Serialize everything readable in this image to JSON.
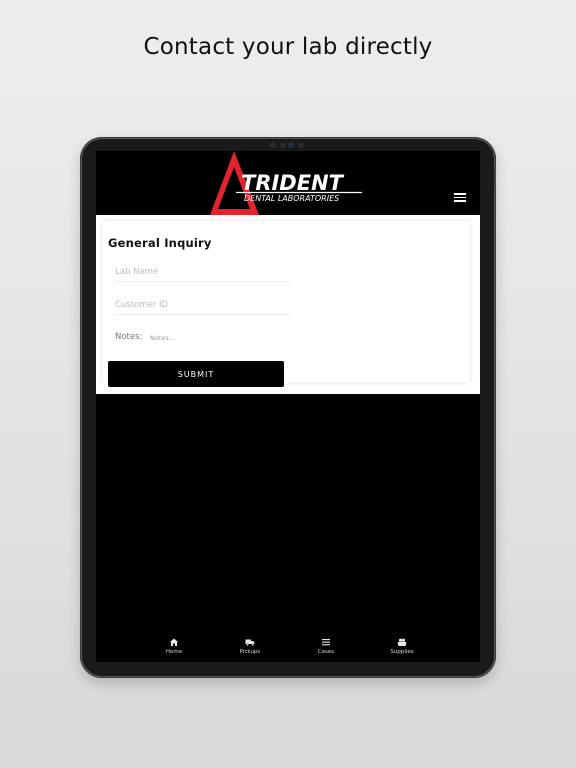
{
  "headline": "Contact your lab directly",
  "logo": {
    "brand": "TRIDENT",
    "tagline": "DENTAL LABORATORIES"
  },
  "form": {
    "title": "General Inquiry",
    "lab_name_placeholder": "Lab Name",
    "customer_id_placeholder": "Customer ID",
    "notes_label": "Notes:",
    "notes_placeholder": "Notes...",
    "submit_label": "SUBMIT"
  },
  "tabs": [
    {
      "label": "Home",
      "icon": "home-icon"
    },
    {
      "label": "Pickups",
      "icon": "truck-icon"
    },
    {
      "label": "Cases",
      "icon": "list-icon"
    },
    {
      "label": "Supplies",
      "icon": "supplies-icon"
    }
  ],
  "colors": {
    "brand_red": "#e3232b",
    "app_background": "#000000",
    "card_background": "#ffffff"
  }
}
